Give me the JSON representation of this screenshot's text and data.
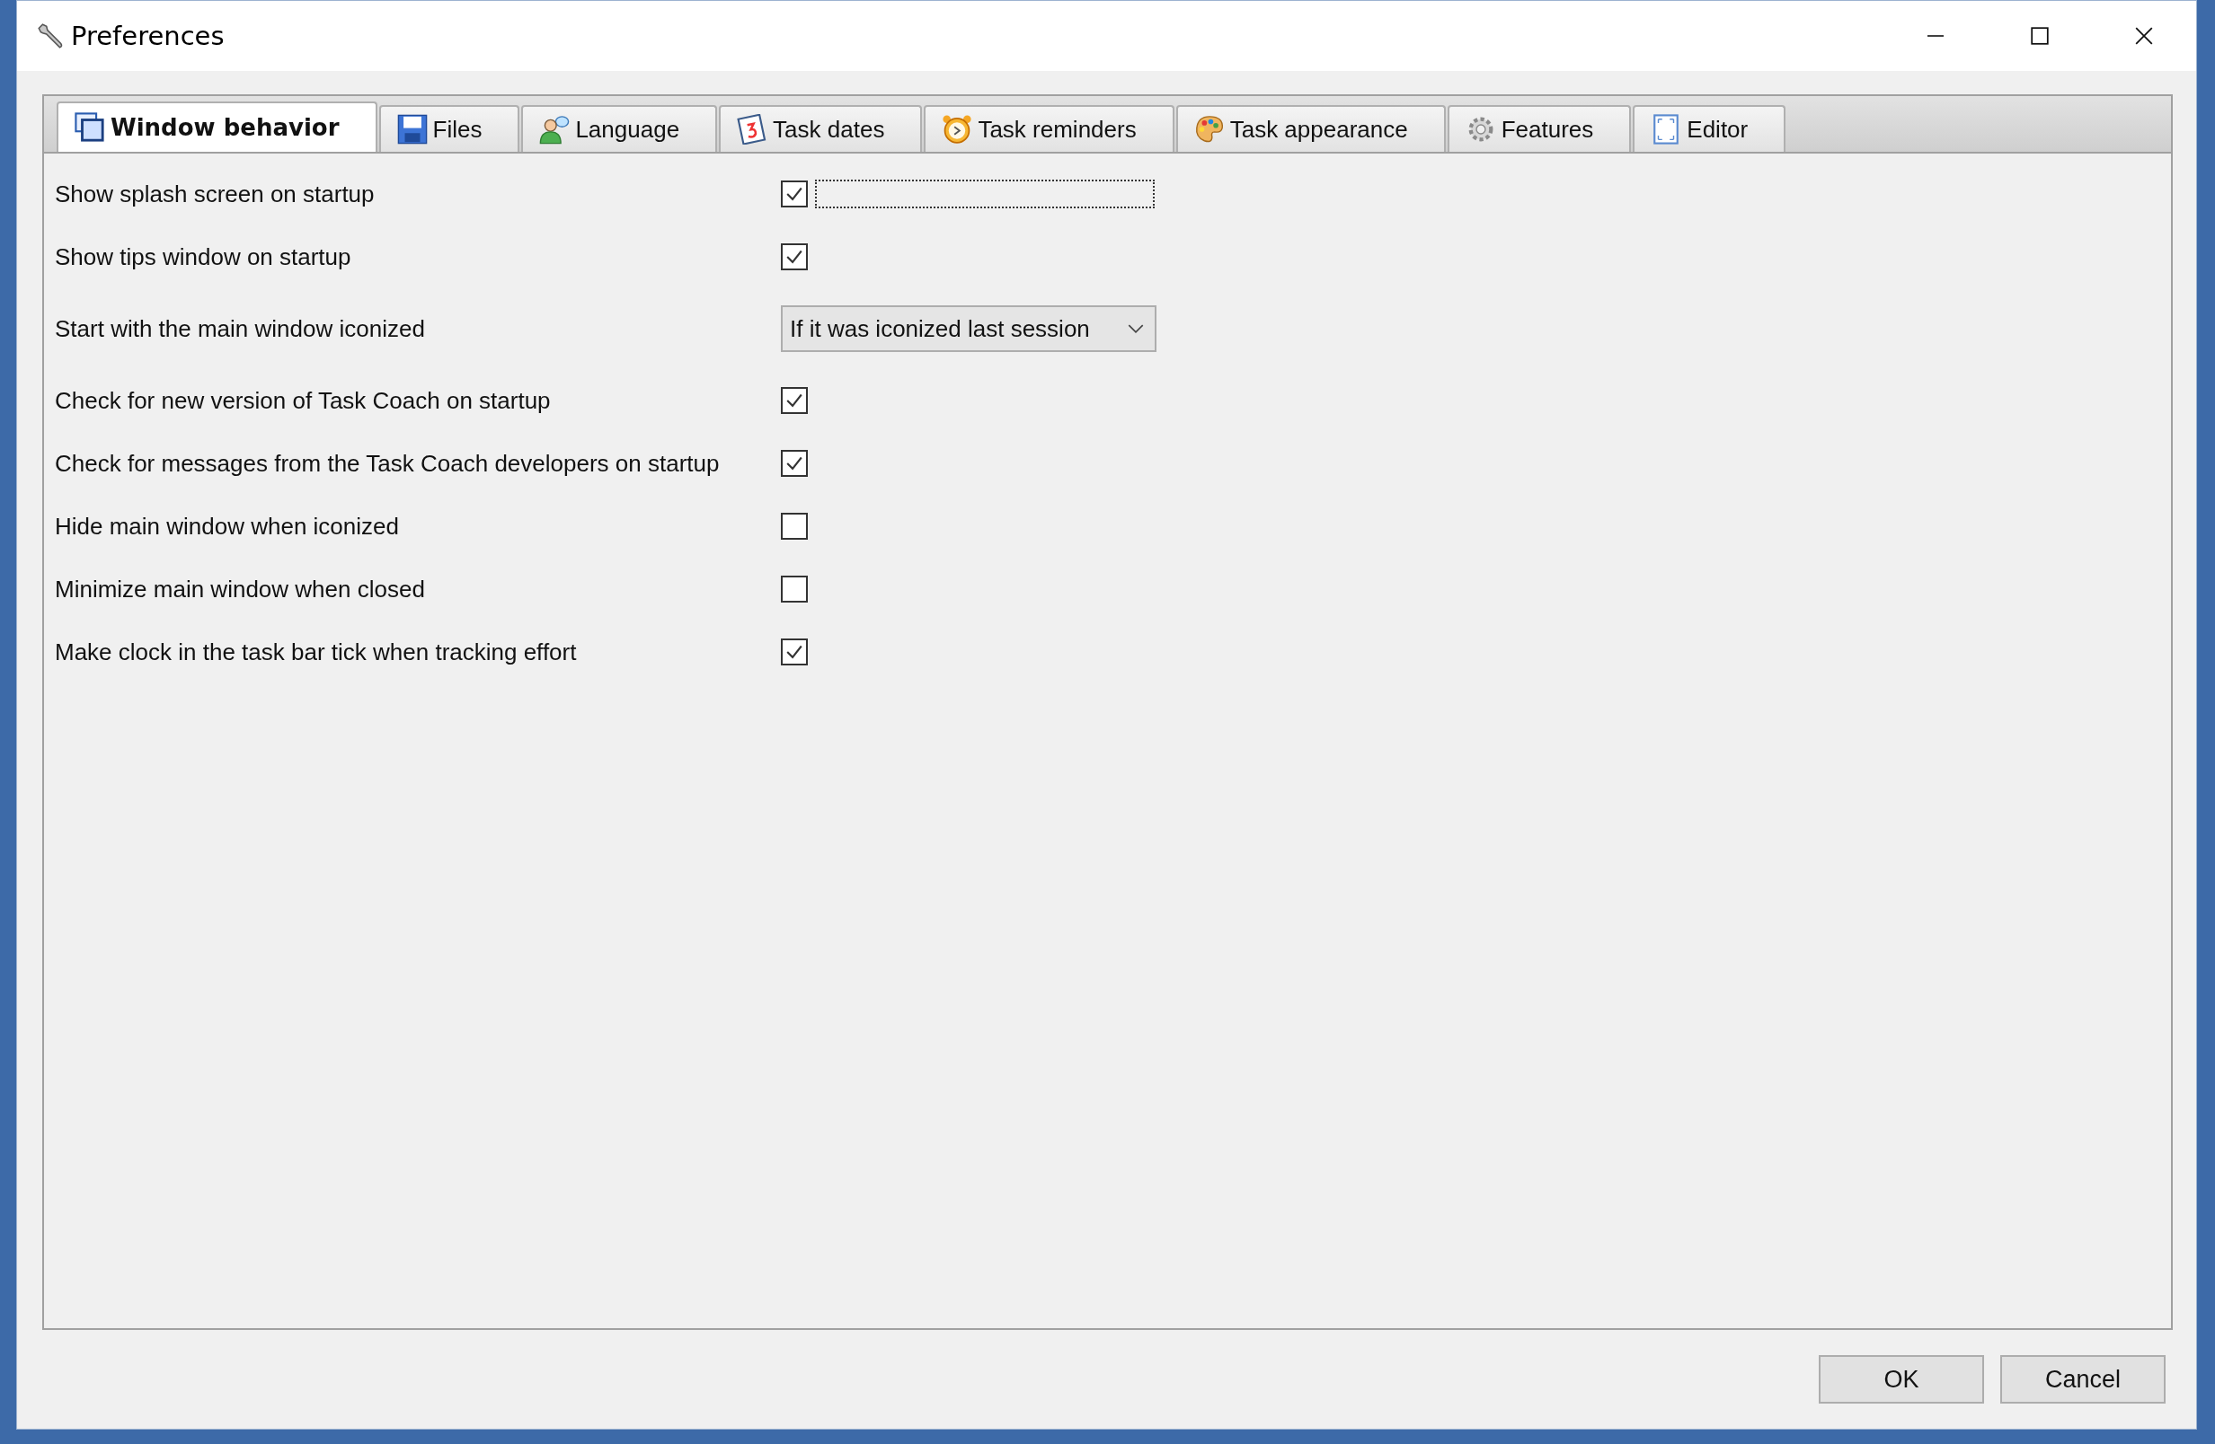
{
  "window": {
    "title": "Preferences"
  },
  "tabs": [
    {
      "label": "Window behavior",
      "selected": true
    },
    {
      "label": "Files",
      "selected": false
    },
    {
      "label": "Language",
      "selected": false
    },
    {
      "label": "Task dates",
      "selected": false
    },
    {
      "label": "Task reminders",
      "selected": false
    },
    {
      "label": "Task appearance",
      "selected": false
    },
    {
      "label": "Features",
      "selected": false
    },
    {
      "label": "Editor",
      "selected": false
    }
  ],
  "settings": [
    {
      "kind": "checkbox",
      "label": "Show splash screen on startup",
      "checked": true,
      "focused": true
    },
    {
      "kind": "checkbox",
      "label": "Show tips window on startup",
      "checked": true,
      "focused": false
    },
    {
      "kind": "choice",
      "label": "Start with the main window iconized",
      "value": "If it was iconized last session",
      "focused": false
    },
    {
      "kind": "checkbox",
      "label": "Check for new version of Task Coach on startup",
      "checked": true,
      "focused": false
    },
    {
      "kind": "checkbox",
      "label": "Check for messages from the Task Coach developers on startup",
      "checked": true,
      "focused": false
    },
    {
      "kind": "checkbox",
      "label": "Hide main window when iconized",
      "checked": false,
      "focused": false
    },
    {
      "kind": "checkbox",
      "label": "Minimize main window when closed",
      "checked": false,
      "focused": false
    },
    {
      "kind": "checkbox",
      "label": "Make clock in the task bar tick when tracking effort",
      "checked": true,
      "focused": false
    }
  ],
  "buttons": [
    "OK",
    "Cancel"
  ]
}
